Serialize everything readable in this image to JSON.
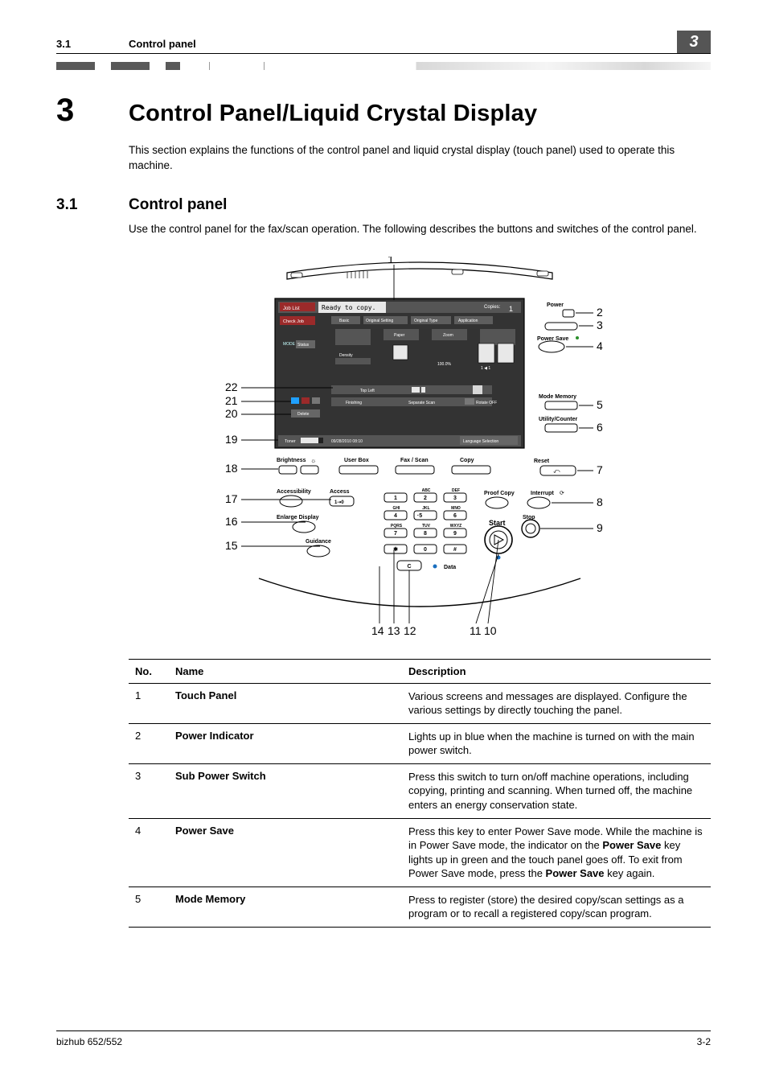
{
  "header": {
    "section_no": "3.1",
    "section_title": "Control panel",
    "chapter_badge": "3"
  },
  "chapter": {
    "number": "3",
    "title": "Control Panel/Liquid Crystal Display",
    "intro": "This section explains the functions of the control panel and liquid crystal display (touch panel) used to operate this machine."
  },
  "section": {
    "number": "3.1",
    "title": "Control panel",
    "text": "Use the control panel for the fax/scan operation. The following describes the buttons and switches of the control panel."
  },
  "figure": {
    "callouts_top": "1",
    "callouts_left": [
      "22",
      "21",
      "20",
      "19",
      "18",
      "17",
      "16",
      "15"
    ],
    "callouts_right": [
      "2",
      "3",
      "4",
      "5",
      "6",
      "7",
      "8",
      "9"
    ],
    "callouts_bottom": [
      "14",
      "13",
      "12",
      "11",
      "10"
    ],
    "panel_labels": {
      "power": "Power",
      "power_save": "Power Save",
      "mode_memory": "Mode Memory",
      "utility_counter": "Utility/Counter",
      "reset": "Reset",
      "interrupt": "Interrupt",
      "stop": "Stop",
      "start": "Start",
      "proof_copy": "Proof Copy",
      "brightness": "Brightness",
      "accessibility": "Accessibility",
      "access": "Access",
      "enlarge_display": "Enlarge Display",
      "guidance": "Guidance",
      "user_box": "User Box",
      "fax_scan": "Fax / Scan",
      "copy": "Copy",
      "data": "Data",
      "c_key": "C",
      "ready": "Ready to copy.",
      "job_list": "Job List",
      "check_job": "Check Job",
      "status": "Status",
      "mode": "MODE",
      "basic": "Basic",
      "original_setting": "Original Setting",
      "original_type": "Original Type",
      "application": "Application",
      "paper": "Paper",
      "zoom": "Zoom",
      "density": "Density",
      "finishing": "Finishing",
      "separate_scan": "Separate Scan",
      "top_left": "Top Left",
      "auto_rotate_off": "Auto Rotate OFF",
      "delete": "Delete",
      "toner": "Toner",
      "language_selection": "Language Selection",
      "copies_label": "Copies:",
      "copies_val": "1",
      "scale": "100.0%",
      "keypad_abc": "ABC",
      "keypad_def": "DEF",
      "keypad_ghi": "GHI",
      "keypad_jkl": "JKL",
      "keypad_mno": "MNO",
      "keypad_pqrs": "PQRS",
      "keypad_tuv": "TUV",
      "keypad_wxyz": "WXYZ"
    }
  },
  "table": {
    "headers": {
      "no": "No.",
      "name": "Name",
      "desc": "Description"
    },
    "rows": [
      {
        "no": "1",
        "name": "Touch Panel",
        "desc": "Various screens and messages are displayed. Configure the various settings by directly touching the panel."
      },
      {
        "no": "2",
        "name": "Power Indicator",
        "desc": "Lights up in blue when the machine is turned on with the main power switch."
      },
      {
        "no": "3",
        "name": "Sub Power Switch",
        "desc": "Press this switch to turn on/off machine operations, including copying, printing and scanning. When turned off, the machine enters an energy conservation state."
      },
      {
        "no": "4",
        "name": "Power Save",
        "desc_parts": [
          "Press this key to enter Power Save mode. While the machine is in Power Save mode, the indicator on the ",
          "Power Save",
          " key lights up in green and the touch panel goes off. To exit from Power Save mode, press the ",
          "Power Save",
          " key again."
        ]
      },
      {
        "no": "5",
        "name": "Mode Memory",
        "desc": "Press to register (store) the desired copy/scan settings as a program or to recall a registered copy/scan program."
      }
    ]
  },
  "footer": {
    "left": "bizhub 652/552",
    "right": "3-2"
  }
}
